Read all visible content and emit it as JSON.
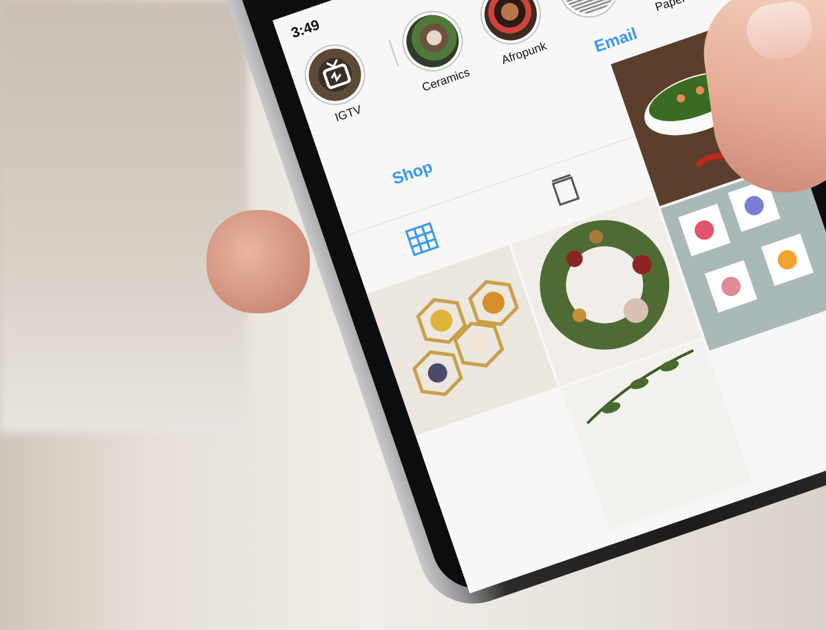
{
  "status_bar": {
    "time": "3:49"
  },
  "highlights": [
    {
      "label": "IGTV",
      "icon": "igtv-icon"
    },
    {
      "label": "Ceramics"
    },
    {
      "label": "Afropunk"
    },
    {
      "label": ""
    },
    {
      "label": "Paper Dol"
    }
  ],
  "actions": {
    "email": "Email",
    "shop": "Shop"
  },
  "tabs": [
    {
      "icon": "grid-icon",
      "active": true
    },
    {
      "icon": "igtv-tab-icon",
      "active": false
    },
    {
      "icon": "tagged-icon",
      "active": false
    }
  ],
  "grid": [
    {
      "name": "salad-bowl-photo"
    },
    {
      "name": "wreath-photo"
    },
    {
      "name": "hexagon-pressed-flowers-photo"
    },
    {
      "name": "painted-tiles-photo"
    },
    {
      "name": "plant-photo"
    }
  ],
  "colors": {
    "accent": "#3897f0",
    "divider": "#c7c7c7",
    "screen_bg": "#f7f7f7"
  }
}
